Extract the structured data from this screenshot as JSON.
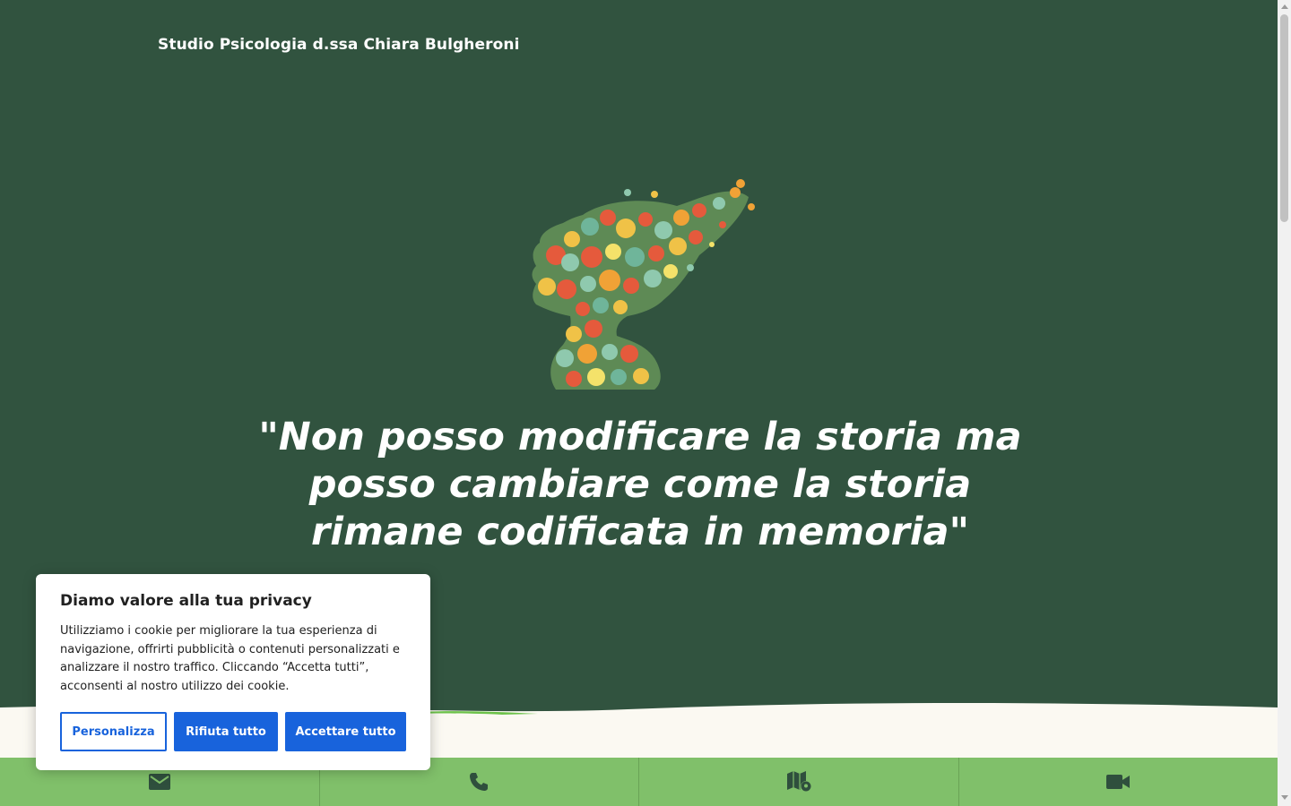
{
  "header": {
    "brand": "Studio Psicologia d.ssa Chiara Bulgheroni"
  },
  "hero": {
    "image": "floral-woman-silhouette",
    "quote": "\"Non posso modificare la storia ma posso cambiare come la storia rimane codificata in memoria\""
  },
  "cookie_banner": {
    "title": "Diamo valore alla tua privacy",
    "text": "Utilizziamo i cookie per migliorare la tua esperienza di navigazione, offrirti pubblicità o contenuti personalizzati e analizzare il nostro traffico. Cliccando “Accetta tutti”, acconsenti al nostro utilizzo dei cookie.",
    "customize_label": "Personalizza",
    "reject_label": "Rifiuta tutto",
    "accept_label": "Accettare tutto"
  },
  "contact_bar": {
    "items": [
      {
        "icon": "email-icon"
      },
      {
        "icon": "phone-icon"
      },
      {
        "icon": "map-icon"
      },
      {
        "icon": "video-call-icon"
      }
    ]
  },
  "colors": {
    "background": "#31533f",
    "contact_bar": "#80c06a",
    "button_blue": "#1863dc",
    "icon_dark": "#2f4f3d"
  }
}
